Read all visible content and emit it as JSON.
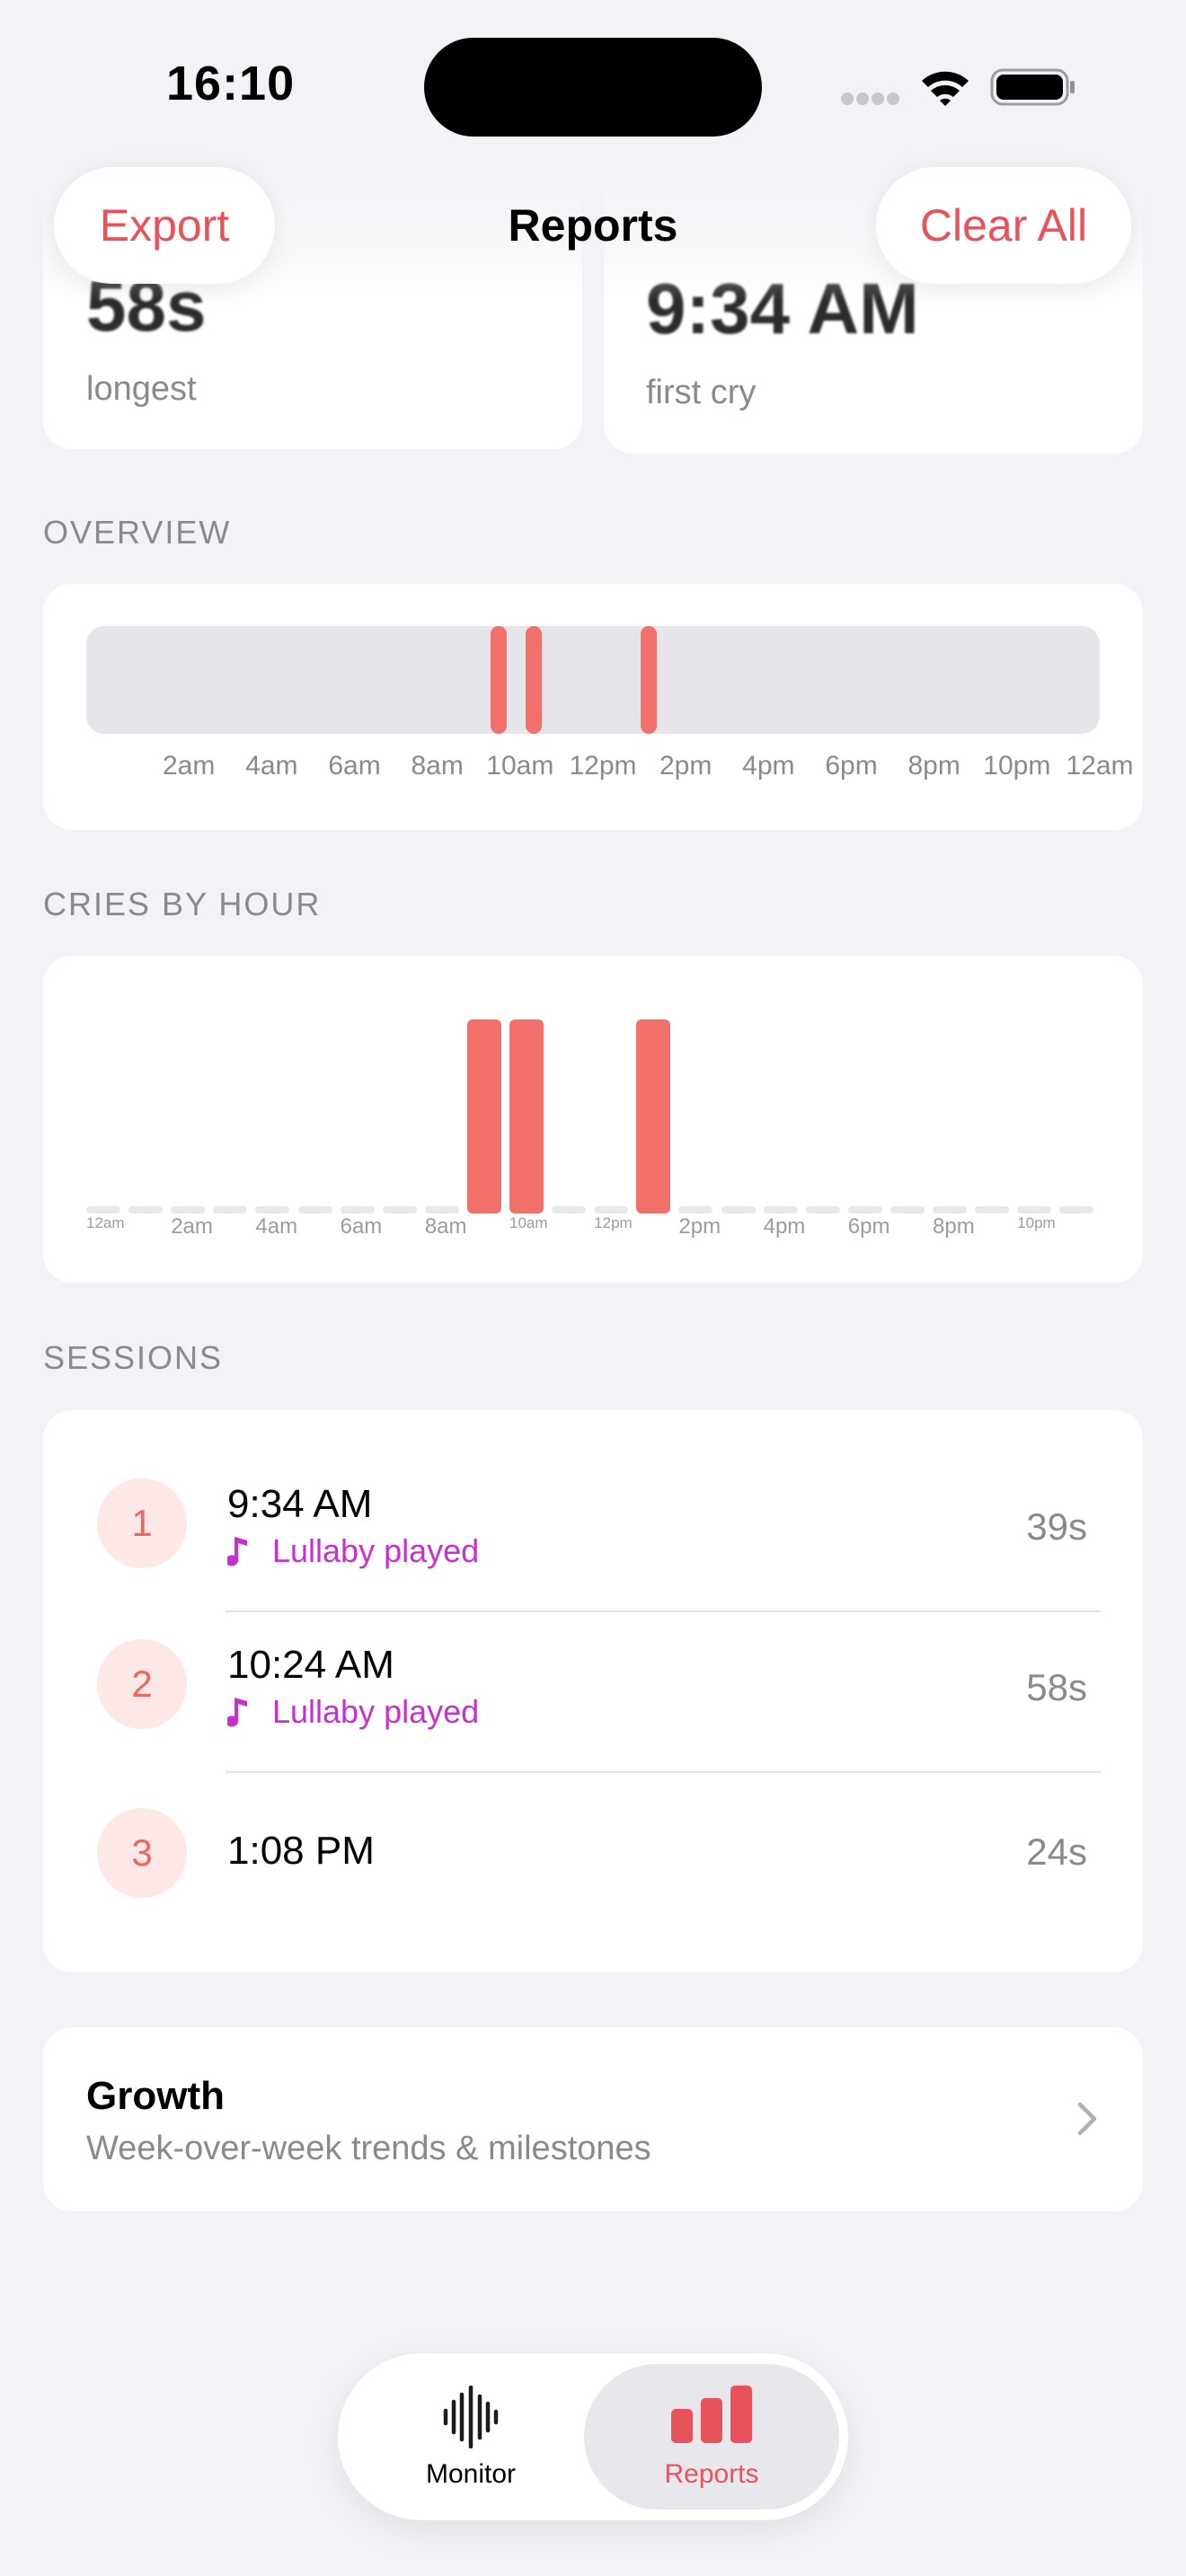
{
  "status_bar": {
    "time": "16:10"
  },
  "header": {
    "title": "Reports",
    "export_label": "Export",
    "clear_label": "Clear All"
  },
  "stats": {
    "longest_value": "58s",
    "longest_label": "longest",
    "first_value": "9:34 AM",
    "first_label": "first cry"
  },
  "overview": {
    "heading": "OVERVIEW",
    "ticks": [
      "2am",
      "4am",
      "6am",
      "8am",
      "10am",
      "12pm",
      "2pm",
      "4pm",
      "6pm",
      "8pm",
      "10pm",
      "12am"
    ]
  },
  "cries_by_hour": {
    "heading": "CRIES BY HOUR",
    "tick_labels": [
      "12am",
      "2am",
      "4am",
      "6am",
      "8am",
      "10am",
      "12pm",
      "2pm",
      "4pm",
      "6pm",
      "8pm",
      "10pm"
    ]
  },
  "chart_data": [
    {
      "type": "timeline",
      "title": "OVERVIEW",
      "x_range_hours": [
        0,
        24
      ],
      "events_start_hour": [
        9.57,
        10.4,
        13.13
      ],
      "tick_labels": [
        "2am",
        "4am",
        "6am",
        "8am",
        "10am",
        "12pm",
        "2pm",
        "4pm",
        "6pm",
        "8pm",
        "10pm",
        "12am"
      ]
    },
    {
      "type": "bar",
      "title": "CRIES BY HOUR",
      "categories": [
        "12am",
        "1am",
        "2am",
        "3am",
        "4am",
        "5am",
        "6am",
        "7am",
        "8am",
        "9am",
        "10am",
        "11am",
        "12pm",
        "1pm",
        "2pm",
        "3pm",
        "4pm",
        "5pm",
        "6pm",
        "7pm",
        "8pm",
        "9pm",
        "10pm",
        "11pm"
      ],
      "values": [
        0,
        0,
        0,
        0,
        0,
        0,
        0,
        0,
        0,
        1,
        1,
        0,
        0,
        1,
        0,
        0,
        0,
        0,
        0,
        0,
        0,
        0,
        0,
        0
      ],
      "ylim": [
        0,
        1
      ]
    }
  ],
  "sessions": {
    "heading": "SESSIONS",
    "items": [
      {
        "number": "1",
        "time": "9:34 AM",
        "note": "Lullaby played",
        "duration": "39s"
      },
      {
        "number": "2",
        "time": "10:24 AM",
        "note": "Lullaby played",
        "duration": "58s"
      },
      {
        "number": "3",
        "time": "1:08 PM",
        "note": "",
        "duration": "24s"
      }
    ]
  },
  "growth": {
    "title": "Growth",
    "subtitle": "Week-over-week trends & milestones"
  },
  "tabbar": {
    "monitor_label": "Monitor",
    "reports_label": "Reports",
    "active": "Reports"
  },
  "colors": {
    "accent": "#e8525a",
    "bar": "#f2706a",
    "lullaby": "#c72fd0",
    "background": "#f2f2f7"
  }
}
